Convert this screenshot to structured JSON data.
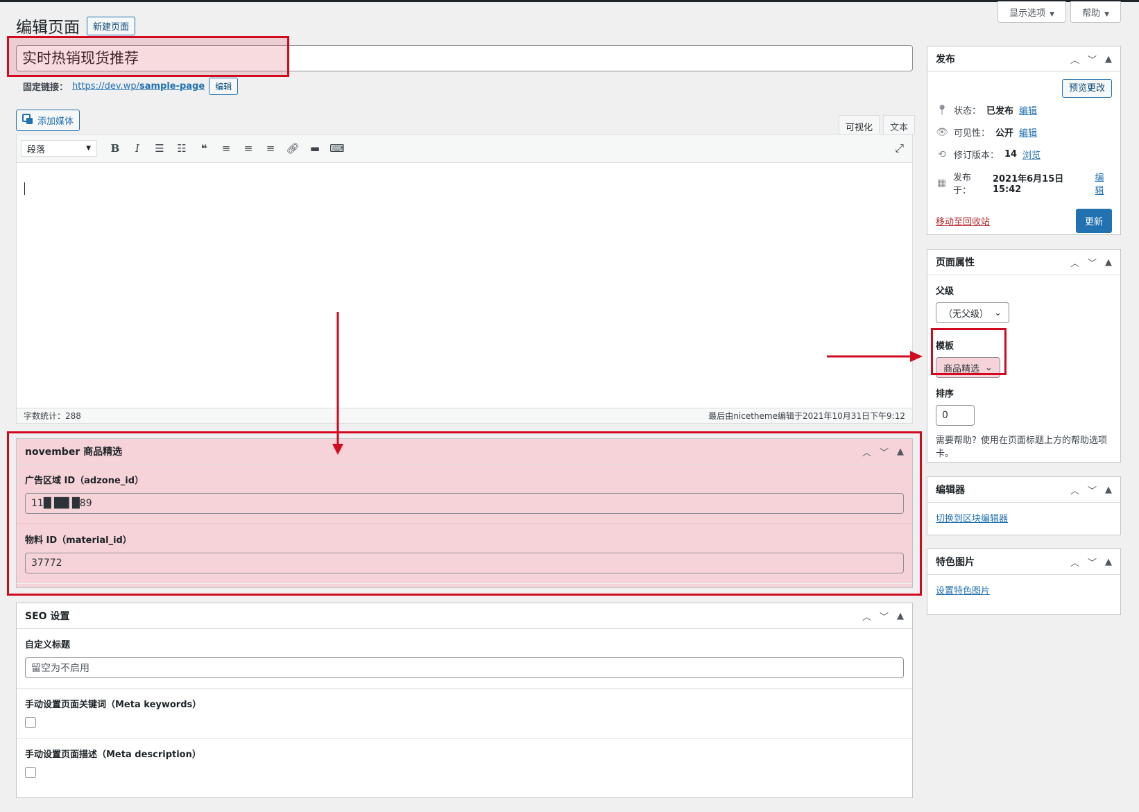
{
  "screen_meta": {
    "screen_options_label": "显示选项",
    "help_label": "帮助"
  },
  "header": {
    "title": "编辑页面",
    "new_page_label": "新建页面"
  },
  "title_field": {
    "value": "实时热销现货推荐"
  },
  "permalink": {
    "label": "固定链接：",
    "url_prefix": "https://dev.wp/",
    "url_slug": "sample-page",
    "edit_label": "编辑"
  },
  "add_media_label": "添加媒体",
  "editor": {
    "tab_visual": "可视化",
    "tab_text": "文本",
    "format_select": "段落",
    "word_count": "字数统计：288",
    "last_edited": "最后由nicetheme编辑于2021年10月31日下午9:12"
  },
  "november_box": {
    "title": "november 商品精选",
    "adzone_label": "广告区域 ID（adzone_id）",
    "adzone_value": "11█ ██ █89",
    "material_label": "物料 ID（material_id）",
    "material_value": "37772"
  },
  "seo_box": {
    "title": "SEO 设置",
    "custom_title_label": "自定义标题",
    "custom_title_placeholder": "留空为不启用",
    "keywords_label": "手动设置页面关键词（Meta keywords）",
    "description_label": "手动设置页面描述（Meta description）"
  },
  "publish_box": {
    "title": "发布",
    "preview_label": "预览更改",
    "status_label": "状态：",
    "status_value": "已发布",
    "visibility_label": "可见性：",
    "visibility_value": "公开",
    "revisions_label": "修订版本：",
    "revisions_value": "14",
    "browse_label": "浏览",
    "published_on_label": "发布于：",
    "published_on_value": "2021年6月15日 15:42",
    "edit_label": "编辑",
    "trash_label": "移动至回收站",
    "update_label": "更新"
  },
  "page_attributes_box": {
    "title": "页面属性",
    "parent_label": "父级",
    "parent_value": "（无父级）",
    "template_label": "模板",
    "template_value": "商品精选",
    "order_label": "排序",
    "order_value": "0",
    "help_text": "需要帮助？使用在页面标题上方的帮助选项卡。"
  },
  "editor_box": {
    "title": "编辑器",
    "switch_label": "切换到区块编辑器"
  },
  "featured_image_box": {
    "title": "特色图片",
    "set_label": "设置特色图片"
  },
  "colors": {
    "highlight": "#d10a1f",
    "link": "#2271b1",
    "primary": "#2271b1"
  }
}
